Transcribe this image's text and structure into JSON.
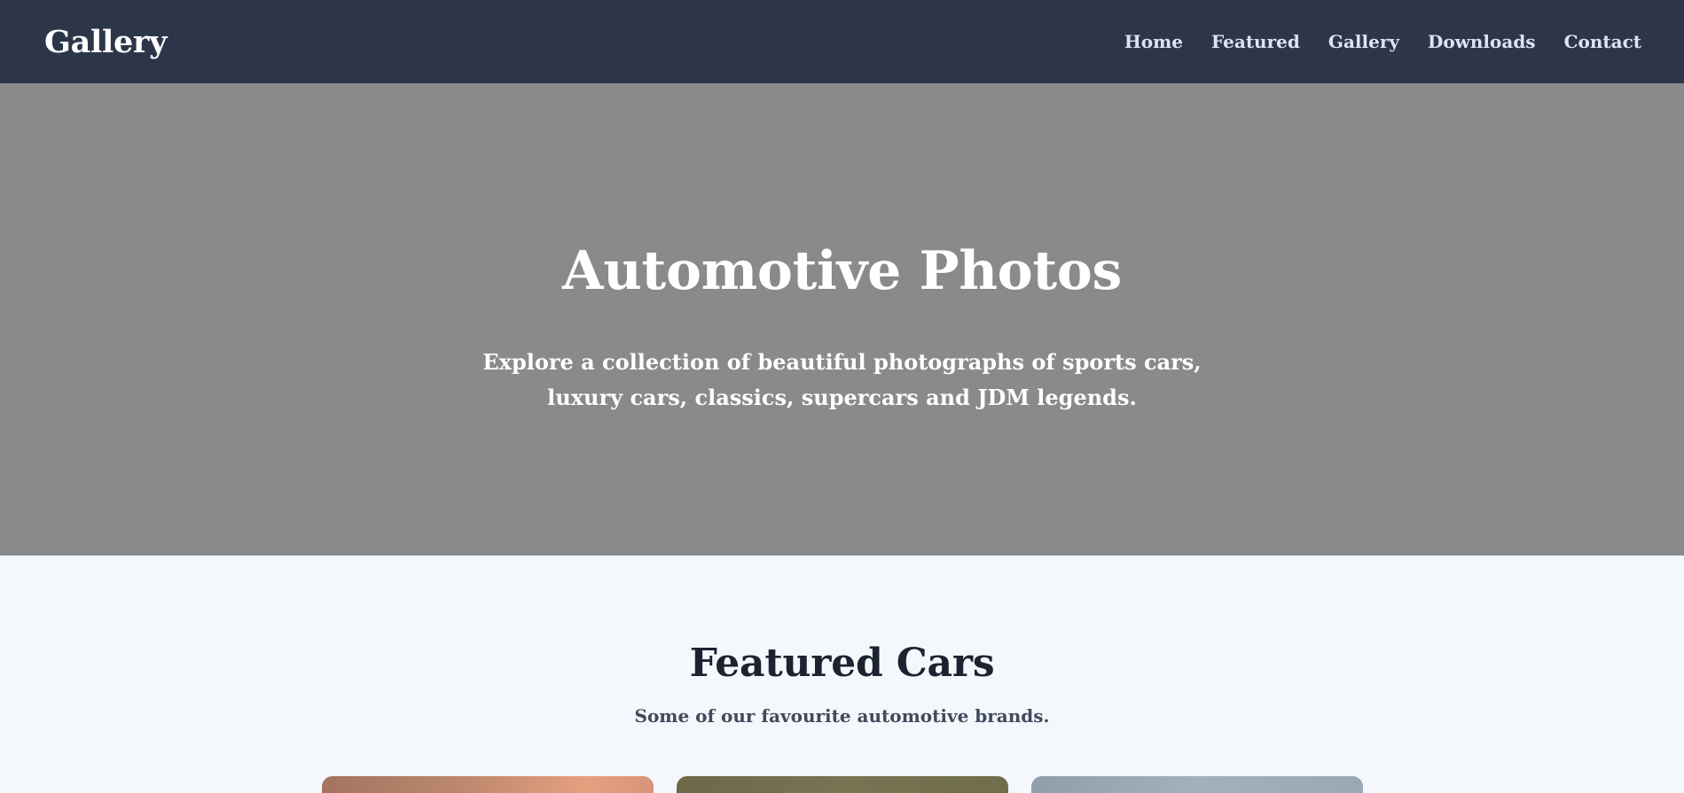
{
  "nav": {
    "brand": "Gallery",
    "links": [
      {
        "label": "Home"
      },
      {
        "label": "Featured"
      },
      {
        "label": "Gallery"
      },
      {
        "label": "Downloads"
      },
      {
        "label": "Contact"
      }
    ]
  },
  "hero": {
    "title": "Automotive Photos",
    "subtitle": "Explore a collection of beautiful photographs of sports cars, luxury cars, classics, supercars and JDM legends."
  },
  "featured": {
    "title": "Featured Cars",
    "subtitle": "Some of our favourite automotive brands."
  },
  "colors": {
    "nav_bg": "#2d3649",
    "hero_bg": "#898a8c",
    "page_bg": "#f4f7fb"
  }
}
